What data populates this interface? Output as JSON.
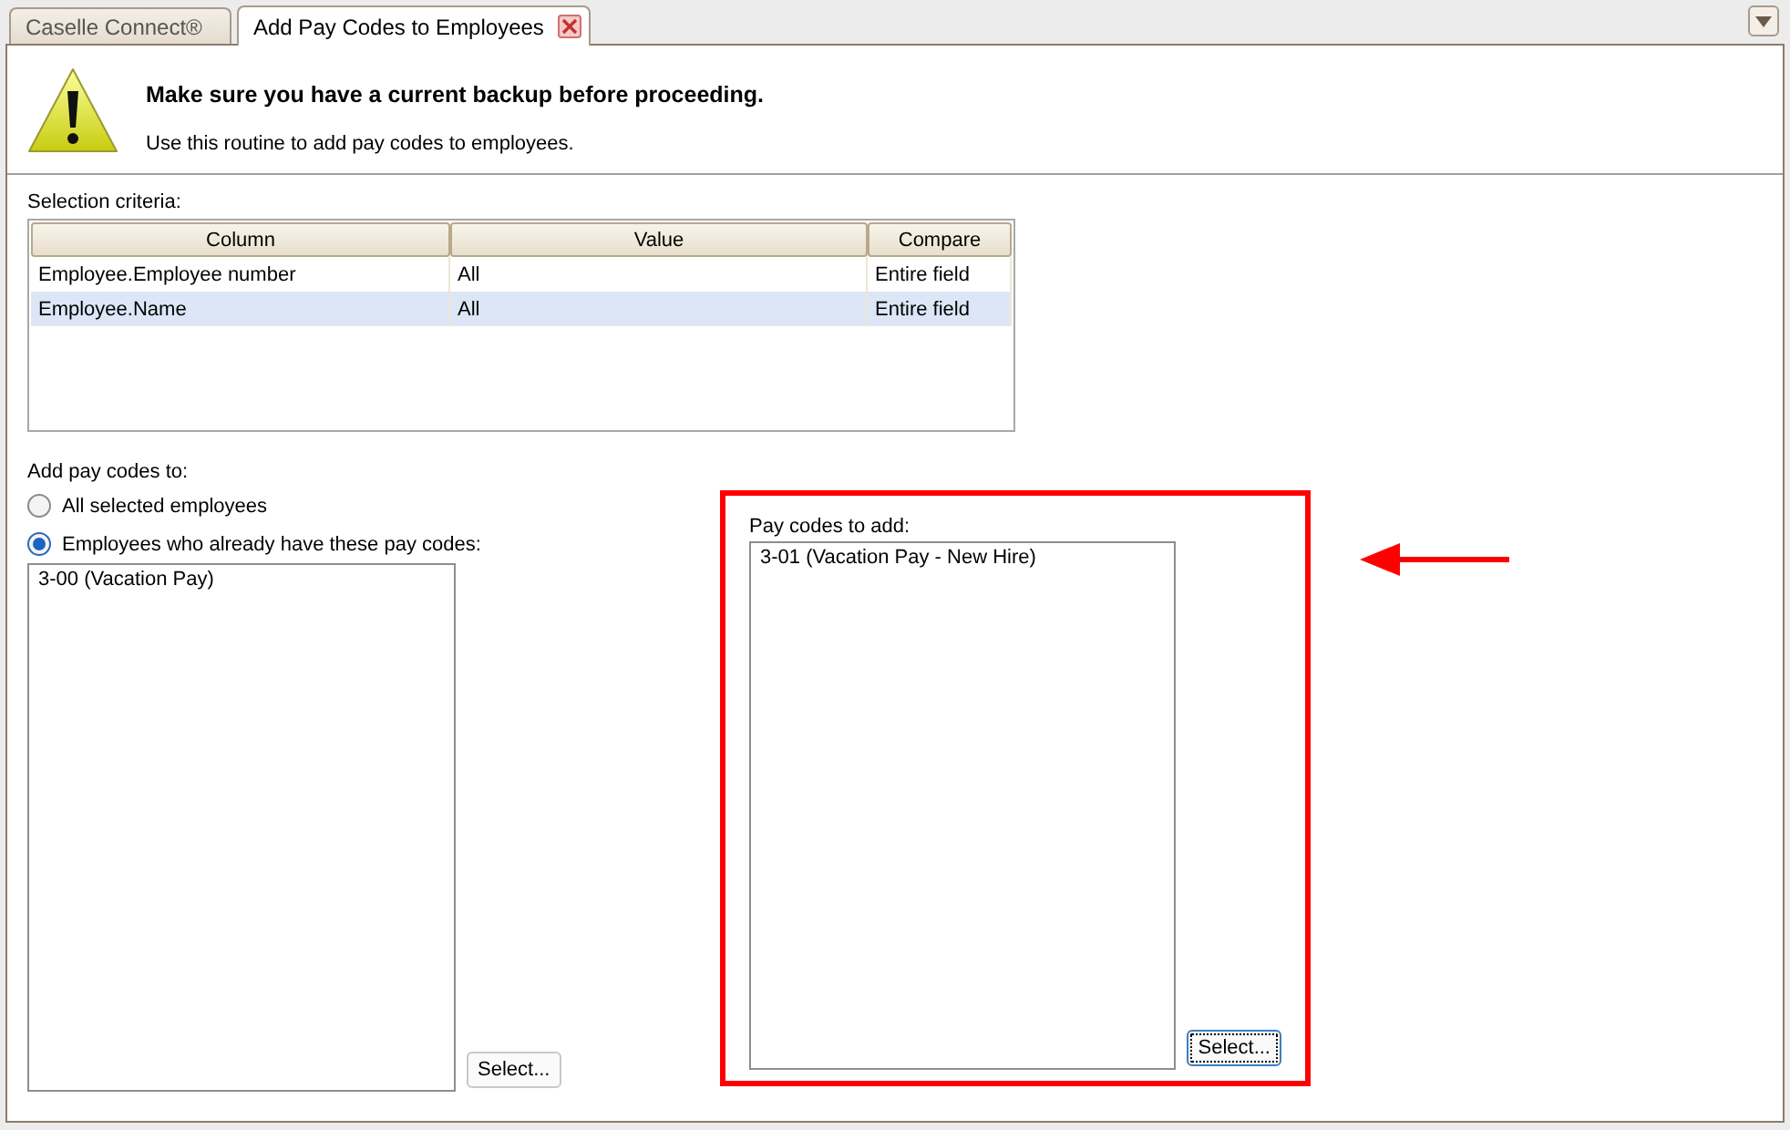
{
  "tabs": [
    {
      "label": "Caselle Connect®",
      "selected": false,
      "closable": false
    },
    {
      "label": "Add Pay Codes to Employees",
      "selected": true,
      "closable": true
    }
  ],
  "header": {
    "title": "Make sure you have a current backup before proceeding.",
    "subtitle": "Use this routine to add pay codes to employees."
  },
  "criteria": {
    "label": "Selection criteria:",
    "columns": [
      "Column",
      "Value",
      "Compare"
    ],
    "rows": [
      {
        "cells": [
          "Employee.Employee number",
          "All",
          "Entire field"
        ],
        "selected": false
      },
      {
        "cells": [
          "Employee.Name",
          "All",
          "Entire field"
        ],
        "selected": true
      }
    ]
  },
  "add_to": {
    "label": "Add pay codes to:",
    "options": [
      {
        "label": "All selected employees",
        "selected": false
      },
      {
        "label": "Employees who already have these pay codes:",
        "selected": true
      }
    ],
    "list_items": [
      "3-00 (Vacation Pay)"
    ],
    "button": "Select..."
  },
  "pay_codes": {
    "label": "Pay codes to add:",
    "list_items": [
      "3-01 (Vacation Pay - New Hire)"
    ],
    "button": "Select..."
  }
}
